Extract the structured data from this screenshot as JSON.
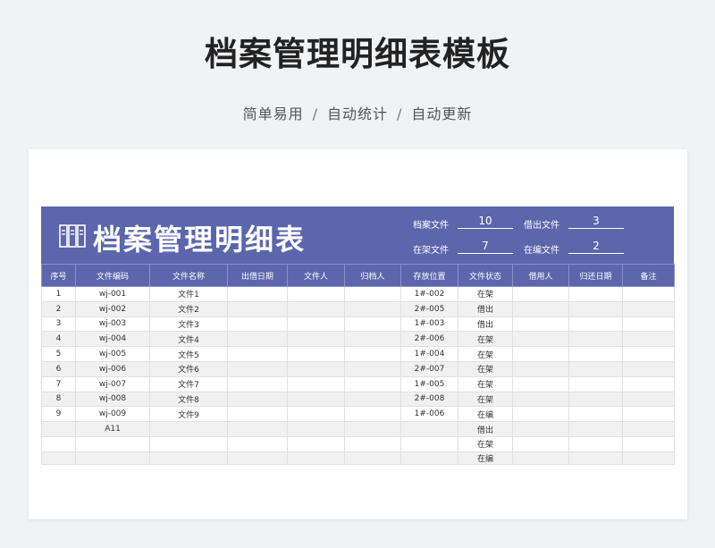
{
  "header": {
    "title": "档案管理明细表模板",
    "tags": [
      "简单易用",
      "自动统计",
      "自动更新"
    ],
    "separator": "/"
  },
  "document": {
    "title": "档案管理明细表",
    "icon": "archive-folders-icon",
    "stats": {
      "archived_label": "档案文件",
      "archived_value": "10",
      "borrowed_label": "借出文件",
      "borrowed_value": "3",
      "on_shelf_label": "在架文件",
      "on_shelf_value": "7",
      "editing_label": "在编文件",
      "editing_value": "2"
    },
    "columns": [
      "序号",
      "文件编码",
      "文件名称",
      "出借日期",
      "文件人",
      "归档人",
      "存放位置",
      "文件状态",
      "借用人",
      "归还日期",
      "备注"
    ],
    "rows": [
      [
        "1",
        "wj-001",
        "文件1",
        "",
        "",
        "",
        "1#-002",
        "在架",
        "",
        "",
        ""
      ],
      [
        "2",
        "wj-002",
        "文件2",
        "",
        "",
        "",
        "2#-005",
        "借出",
        "",
        "",
        ""
      ],
      [
        "3",
        "wj-003",
        "文件3",
        "",
        "",
        "",
        "1#-003",
        "借出",
        "",
        "",
        ""
      ],
      [
        "4",
        "wj-004",
        "文件4",
        "",
        "",
        "",
        "2#-006",
        "在架",
        "",
        "",
        ""
      ],
      [
        "5",
        "wj-005",
        "文件5",
        "",
        "",
        "",
        "1#-004",
        "在架",
        "",
        "",
        ""
      ],
      [
        "6",
        "wj-006",
        "文件6",
        "",
        "",
        "",
        "2#-007",
        "在架",
        "",
        "",
        ""
      ],
      [
        "7",
        "wj-007",
        "文件7",
        "",
        "",
        "",
        "1#-005",
        "在架",
        "",
        "",
        ""
      ],
      [
        "8",
        "wj-008",
        "文件8",
        "",
        "",
        "",
        "2#-008",
        "在架",
        "",
        "",
        ""
      ],
      [
        "9",
        "wj-009",
        "文件9",
        "",
        "",
        "",
        "1#-006",
        "在编",
        "",
        "",
        ""
      ],
      [
        "",
        "A11",
        "",
        "",
        "",
        "",
        "",
        "借出",
        "",
        "",
        ""
      ],
      [
        "",
        "",
        "",
        "",
        "",
        "",
        "",
        "在架",
        "",
        "",
        ""
      ],
      [
        "",
        "",
        "",
        "",
        "",
        "",
        "",
        "在编",
        "",
        "",
        ""
      ]
    ]
  },
  "colors": {
    "accent": "#5b66ad",
    "row_alt": "#f1f1f1",
    "page_bg": "#f1f2f4"
  }
}
